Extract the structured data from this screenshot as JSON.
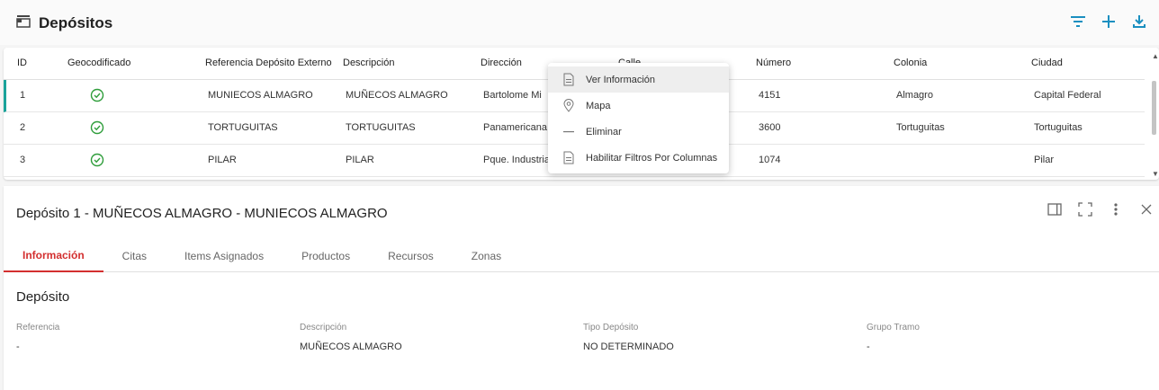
{
  "header": {
    "title": "Depósitos",
    "icons": [
      "store-icon",
      "filter-icon",
      "plus-icon",
      "download-icon"
    ]
  },
  "table": {
    "columns": [
      "ID",
      "Geocodificado",
      "Referencia Depósito Externo",
      "Descripción",
      "Dirección",
      "Calle",
      "Número",
      "Colonia",
      "Ciudad"
    ],
    "rows": [
      {
        "id": "1",
        "geocoded": true,
        "ref": "MUNIECOS ALMAGRO",
        "desc": "MUÑECOS ALMAGRO",
        "dir": "Bartolome Mi",
        "numero": "4151",
        "colonia": "Almagro",
        "ciudad": "Capital Federal"
      },
      {
        "id": "2",
        "geocoded": true,
        "ref": "TORTUGUITAS",
        "desc": "TORTUGUITAS",
        "dir": "Panamericana",
        "numero": "3600",
        "colonia": "Tortuguitas",
        "ciudad": "Tortuguitas"
      },
      {
        "id": "3",
        "geocoded": true,
        "ref": "PILAR",
        "desc": "PILAR",
        "dir": "Pque. Industria",
        "numero": "1074",
        "colonia": "",
        "ciudad": "Pilar"
      }
    ]
  },
  "context_menu": {
    "items": [
      {
        "label": "Ver Información",
        "icon": "document-icon"
      },
      {
        "label": "Mapa",
        "icon": "map-pin-icon"
      },
      {
        "label": "Eliminar",
        "icon": "minus-icon"
      },
      {
        "label": "Habilitar Filtros Por Columnas",
        "icon": "document-icon"
      }
    ]
  },
  "detail": {
    "title": "Depósito 1 - MUÑECOS ALMAGRO - MUNIECOS ALMAGRO",
    "tabs": [
      "Información",
      "Citas",
      "Items Asignados",
      "Productos",
      "Recursos",
      "Zonas"
    ],
    "active_tab": "Información",
    "section_title": "Depósito",
    "fields": [
      {
        "label": "Referencia",
        "value": "-"
      },
      {
        "label": "Descripción",
        "value": "MUÑECOS ALMAGRO"
      },
      {
        "label": "Tipo Depósito",
        "value": "NO DETERMINADO"
      },
      {
        "label": "Grupo Tramo",
        "value": "-"
      }
    ]
  },
  "colors": {
    "accent": "#d32f2f",
    "teal": "#1aa39a",
    "check_green": "#2e9d3a"
  }
}
